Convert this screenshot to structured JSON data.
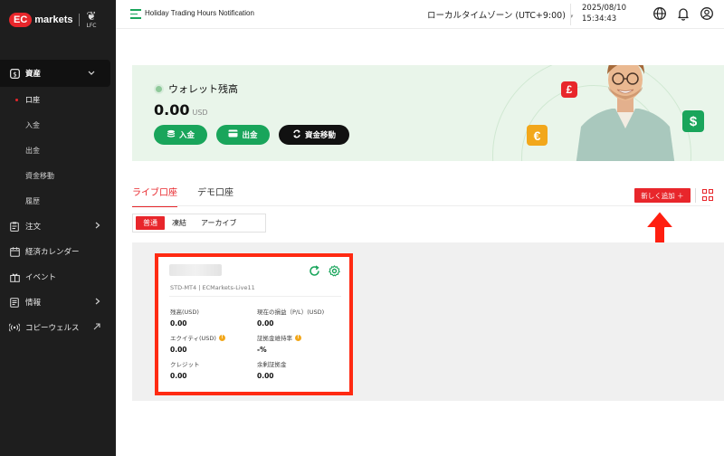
{
  "brand": {
    "logo_text": "EC",
    "name": "markets",
    "partner": "LFC"
  },
  "sidebar": {
    "items": [
      {
        "label": "資産"
      },
      {
        "label": "口座"
      },
      {
        "label": "入金"
      },
      {
        "label": "出金"
      },
      {
        "label": "資金移動"
      },
      {
        "label": "履歴"
      },
      {
        "label": "注文"
      },
      {
        "label": "経済カレンダー"
      },
      {
        "label": "イベント"
      },
      {
        "label": "情報"
      },
      {
        "label": "コピーウェルス"
      }
    ]
  },
  "topbar": {
    "notification": "Holiday Trading Hours Notification",
    "timezone": "ローカルタイムゾーン (UTC+9:00)",
    "date": "2025/08/10",
    "time": "15:34:43"
  },
  "wallet": {
    "title": "ウォレット残高",
    "balance": "0.00",
    "currency": "USD",
    "deposit_label": "入金",
    "withdraw_label": "出金",
    "transfer_label": "資金移動",
    "badges": {
      "pound": "£",
      "euro": "€",
      "dollar": "$"
    }
  },
  "tabs": {
    "live": "ライブ口座",
    "demo": "デモ口座"
  },
  "add_button": "新しく追加 ＋",
  "segments": {
    "normal": "普通",
    "frozen": "凍結",
    "archive": "アーカイブ"
  },
  "account_card": {
    "subtitle": "STD-MT4 | ECMarkets-Live11",
    "balance_label": "残高(USD)",
    "balance_value": "0.00",
    "pl_label": "現在の損益（P/L）(USD)",
    "pl_value": "0.00",
    "equity_label": "エクイティ(USD)",
    "equity_value": "0.00",
    "margin_level_label": "証拠金維持率",
    "margin_level_value": "-%",
    "credit_label": "クレジット",
    "credit_value": "0.00",
    "free_margin_label": "余剰証拠金",
    "free_margin_value": "0.00"
  },
  "colors": {
    "accent_red": "#e8262b",
    "brand_green": "#19a55b",
    "sidebar_bg": "#1e1e1e",
    "banner_bg": "#e9f5ea",
    "highlight_border": "#ff2a12"
  }
}
